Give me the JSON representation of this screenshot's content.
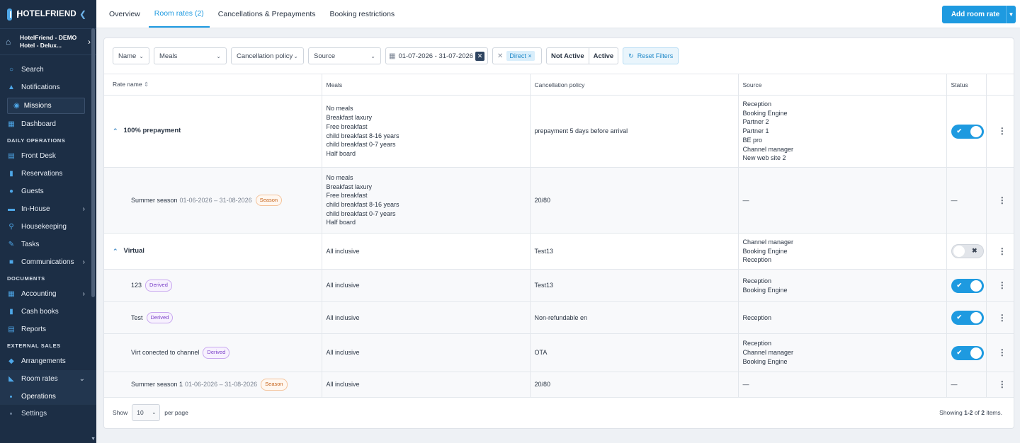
{
  "app": {
    "brand": "HOTELFRIEND",
    "hotel": [
      "HotelFriend - DEMO",
      "Hotel - Delux..."
    ]
  },
  "sidebar": {
    "top_items": [
      {
        "label": "Search",
        "icon": "search-icon"
      },
      {
        "label": "Notifications",
        "icon": "bell-icon"
      }
    ],
    "missions": "Missions",
    "dashboard": "Dashboard",
    "section_daily": "DAILY OPERATIONS",
    "daily": [
      {
        "label": "Front Desk",
        "icon": "calendar-icon"
      },
      {
        "label": "Reservations",
        "icon": "book-icon"
      },
      {
        "label": "Guests",
        "icon": "user-icon"
      },
      {
        "label": "In-House",
        "icon": "bed-icon",
        "chevron": true
      },
      {
        "label": "Housekeeping",
        "icon": "broom-icon"
      },
      {
        "label": "Tasks",
        "icon": "wrench-icon"
      },
      {
        "label": "Communications",
        "icon": "chat-icon",
        "chevron": true
      }
    ],
    "section_documents": "DOCUMENTS",
    "documents": [
      {
        "label": "Accounting",
        "icon": "grid-icon",
        "chevron": true
      },
      {
        "label": "Cash books",
        "icon": "cashbook-icon"
      },
      {
        "label": "Reports",
        "icon": "report-icon"
      }
    ],
    "section_external": "EXTERNAL SALES",
    "external": [
      {
        "label": "Arrangements",
        "icon": "tag-icon"
      },
      {
        "label": "Room rates",
        "icon": "chart-icon",
        "chevron": true
      }
    ],
    "sub": [
      "Operations",
      "Settings"
    ]
  },
  "header": {
    "tabs": [
      "Overview",
      "Room rates (2)",
      "Cancellations & Prepayments",
      "Booking restrictions"
    ],
    "add_button": "Add room rate"
  },
  "filters": {
    "name": "Name",
    "meals": "Meals",
    "cancellation": "Cancellation policy",
    "source": "Source",
    "date": "01-07-2026 - 31-07-2026",
    "chip": "Direct",
    "not_active": "Not Active",
    "active": "Active",
    "reset": "Reset Filters"
  },
  "table": {
    "headers": [
      "Rate name",
      "Meals",
      "Cancellation policy",
      "Source",
      "Status"
    ],
    "rows": [
      {
        "name": "100% prepayment",
        "meals": "No meals\nBreakfast laxury\nFree breakfast\nchild breakfast 8-16 years\nchild breakfast 0-7 years\nHalf board",
        "cancel": "prepayment 5 days before arrival",
        "source": "Reception\nBooking Engine\nPartner 2\nPartner 1\nBE pro\nChannel manager\nNew web site 2",
        "status": "on"
      },
      {
        "name": "Summer season",
        "dates": "01-06-2026 – 31-08-2026",
        "badge": "Season",
        "meals": "No meals\nBreakfast laxury\nFree breakfast\nchild breakfast 8-16 years\nchild breakfast 0-7 years\nHalf board",
        "cancel": "20/80",
        "source": "—",
        "status": "—"
      },
      {
        "name": "Virtual",
        "meals": "All inclusive",
        "cancel": "Test13",
        "source": "Channel manager\nBooking Engine\nReception",
        "status": "off"
      },
      {
        "name": "123",
        "badge": "Derived",
        "meals": "All inclusive",
        "cancel": "Test13",
        "source": "Reception\nBooking Engine",
        "status": "on"
      },
      {
        "name": "Test",
        "badge": "Derived",
        "meals": "All inclusive",
        "cancel": "Non-refundable en",
        "source": "Reception",
        "status": "on"
      },
      {
        "name": "Virt conected to channel",
        "badge": "Derived",
        "meals": "All inclusive",
        "cancel": "OTA",
        "source": "Reception\nChannel manager\nBooking Engine",
        "status": "on"
      },
      {
        "name": "Summer season 1",
        "dates": "01-06-2026 – 31-08-2026",
        "badge": "Season",
        "meals": "All inclusive",
        "cancel": "20/80",
        "source": "—",
        "status": "—"
      }
    ]
  },
  "footer": {
    "show": "Show",
    "per_page_value": "10",
    "per_page": "per page",
    "showing_prefix": "Showing ",
    "showing_range": "1-2",
    "showing_of": " of ",
    "showing_total": "2",
    "showing_suffix": " items."
  }
}
